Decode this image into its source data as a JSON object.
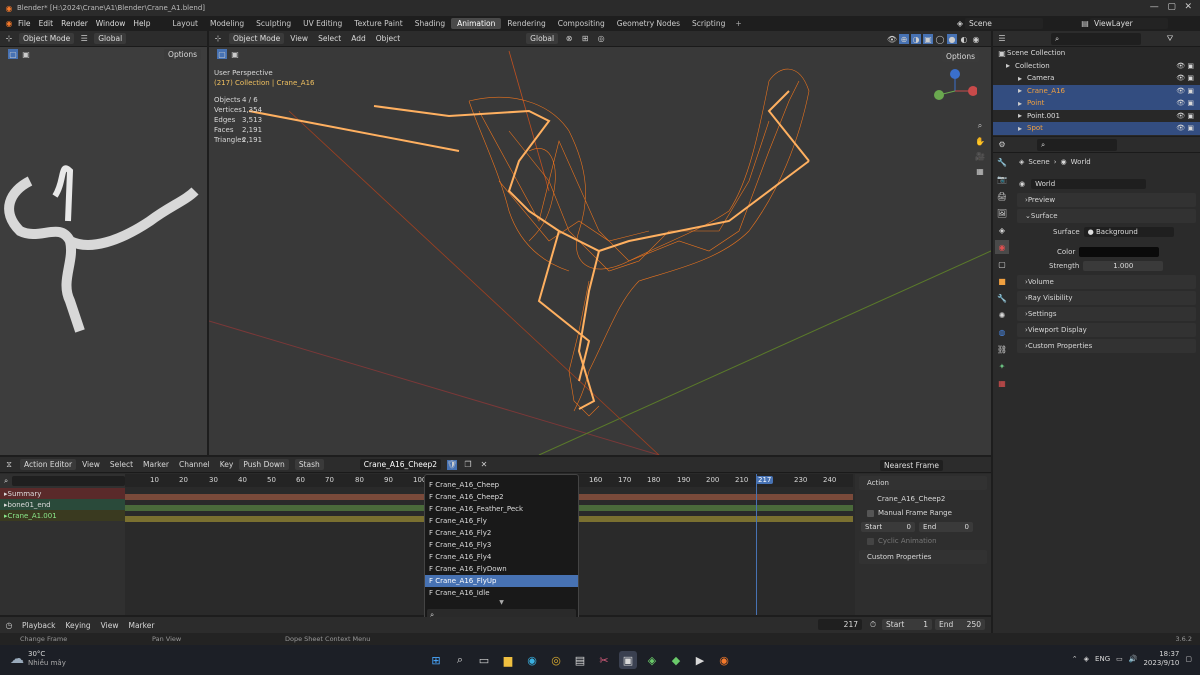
{
  "window": {
    "title": "Blender* [H:\\2024\\Crane\\A1\\Blender\\Crane_A1.blend]"
  },
  "menu": {
    "items": [
      "File",
      "Edit",
      "Render",
      "Window",
      "Help"
    ]
  },
  "workspaces": [
    {
      "label": "Layout"
    },
    {
      "label": "Modeling"
    },
    {
      "label": "Sculpting"
    },
    {
      "label": "UV Editing"
    },
    {
      "label": "Texture Paint"
    },
    {
      "label": "Shading"
    },
    {
      "label": "Animation",
      "active": true
    },
    {
      "label": "Rendering"
    },
    {
      "label": "Compositing"
    },
    {
      "label": "Geometry Nodes"
    },
    {
      "label": "Scripting"
    }
  ],
  "scene": {
    "label": "Scene",
    "viewlayer": "ViewLayer"
  },
  "left_viewport": {
    "mode": "Object Mode",
    "orientation": "Global",
    "options": "Options"
  },
  "main_viewport": {
    "mode": "Object Mode",
    "menus": [
      "View",
      "Select",
      "Add",
      "Object"
    ],
    "orientation": "Global",
    "options": "Options",
    "perspective": "User Perspective",
    "collection_info": "(217) Collection | Crane_A16",
    "stats": [
      {
        "label": "Objects",
        "value": "4 / 6"
      },
      {
        "label": "Vertices",
        "value": "1,354"
      },
      {
        "label": "Edges",
        "value": "3,513"
      },
      {
        "label": "Faces",
        "value": "2,191"
      },
      {
        "label": "Triangles",
        "value": "2,191"
      }
    ]
  },
  "outliner": {
    "root": "Scene Collection",
    "items": [
      {
        "label": "Collection",
        "indent": 0,
        "sel": false,
        "color": "#ddd"
      },
      {
        "label": "Camera",
        "indent": 1,
        "sel": false,
        "color": "#ddd"
      },
      {
        "label": "Crane_A16",
        "indent": 1,
        "sel": true,
        "color": "#f0a040"
      },
      {
        "label": "Point",
        "indent": 1,
        "sel": true,
        "color": "#f0a040"
      },
      {
        "label": "Point.001",
        "indent": 1,
        "sel": false,
        "color": "#ddd"
      },
      {
        "label": "Spot",
        "indent": 1,
        "sel": true,
        "color": "#f0a040"
      }
    ]
  },
  "properties": {
    "breadcrumb_scene": "Scene",
    "breadcrumb_world": "World",
    "world_name": "World",
    "sections": [
      "Preview",
      "Surface",
      "Volume",
      "Ray Visibility",
      "Settings",
      "Viewport Display",
      "Custom Properties"
    ],
    "surface_label": "Surface",
    "surface_value": "Background",
    "color_label": "Color",
    "strength_label": "Strength",
    "strength_value": "1.000"
  },
  "action_editor": {
    "mode": "Action Editor",
    "menus": [
      "View",
      "Select",
      "Marker",
      "Channel",
      "Key"
    ],
    "push_down": "Push Down",
    "stash": "Stash",
    "action_name": "Crane_A16_Cheep2",
    "snap": "Nearest Frame",
    "channels": [
      {
        "label": "Summary",
        "type": "summary"
      },
      {
        "label": "bone01_end",
        "type": "group"
      },
      {
        "label": "Crane_A1.001",
        "type": "action"
      }
    ],
    "frames": [
      "10",
      "20",
      "30",
      "40",
      "50",
      "60",
      "70",
      "80",
      "90",
      "100",
      "160",
      "170",
      "180",
      "190",
      "200",
      "210",
      "217",
      "230",
      "240"
    ],
    "current_frame": "217",
    "side_panel": {
      "action_header": "Action",
      "action_name": "Crane_A16_Cheep2",
      "manual_range": "Manual Frame Range",
      "start_label": "Start",
      "start_val": "0",
      "end_label": "End",
      "end_val": "0",
      "cyclic": "Cyclic Animation",
      "custom_props": "Custom Properties"
    }
  },
  "dropdown": {
    "items": [
      "F Crane_A16_Cheep",
      "F Crane_A16_Cheep2",
      "F Crane_A16_Feather_Peck",
      "F Crane_A16_Fly",
      "F Crane_A16_Fly2",
      "F Crane_A16_Fly3",
      "F Crane_A16_Fly4",
      "F Crane_A16_FlyDown",
      "F Crane_A16_FlyUp",
      "F Crane_A16_Idle"
    ],
    "selected_index": 8
  },
  "timeline": {
    "menus": [
      "Playback",
      "Keying",
      "View",
      "Marker"
    ],
    "frame": "217",
    "start_label": "Start",
    "start": "1",
    "end_label": "End",
    "end": "250"
  },
  "statusbar": {
    "left": "Change Frame",
    "mid": "Pan View",
    "right": "Dope Sheet Context Menu",
    "version": "3.6.2"
  },
  "taskbar": {
    "temp": "30°C",
    "weather": "Nhiều mây",
    "lang": "ENG",
    "time": "18:37",
    "date": "2023/9/10"
  },
  "colors": {
    "accent": "#4772b3",
    "selected": "#334d80",
    "orange": "#f0a040",
    "wire": "#ff7a1a"
  }
}
